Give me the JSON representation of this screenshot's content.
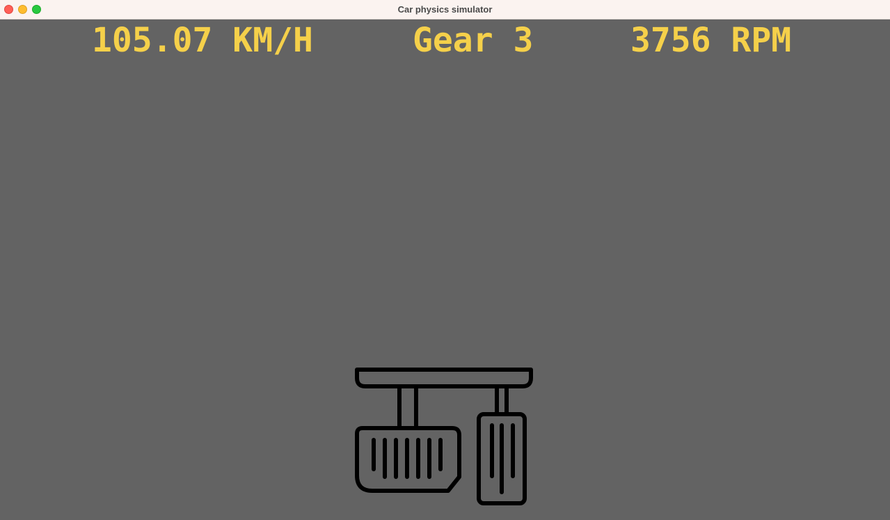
{
  "window": {
    "title": "Car physics simulator"
  },
  "hud": {
    "speed": "105.07 KM/H",
    "gear": "Gear 3",
    "rpm": "3756 RPM"
  },
  "colors": {
    "background": "#636363",
    "hud_text": "#f5d04a",
    "pedal_stroke": "#000000"
  },
  "icons": [
    "pedals-icon"
  ]
}
